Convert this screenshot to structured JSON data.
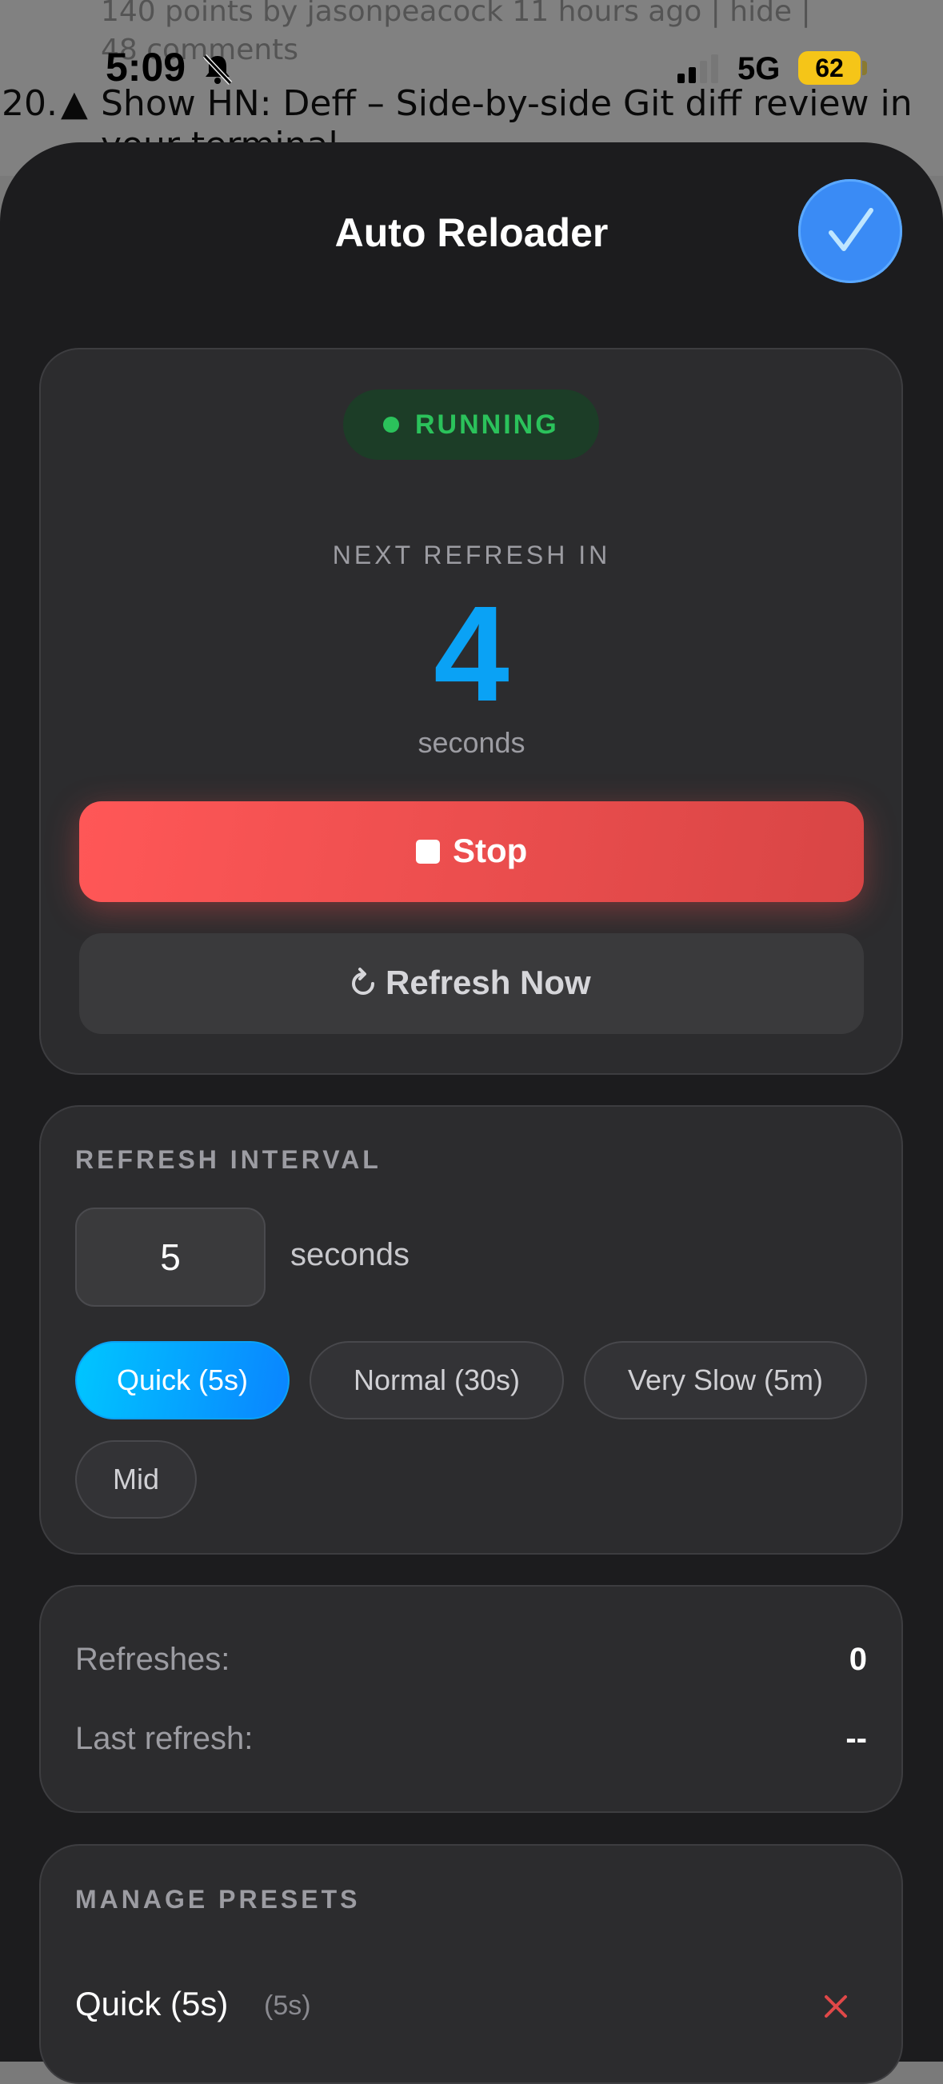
{
  "background_page": {
    "meta_line": "140 points by jasonpeacock 11 hours ago | hide |",
    "comments": "48 comments",
    "item_rank": "20.",
    "item_title": "Show HN: Deff – Side-by-side Git diff review in",
    "item_title_cont": "your terminal"
  },
  "status_bar": {
    "time": "5:09",
    "network": "5G",
    "battery": "62"
  },
  "header": {
    "title": "Auto Reloader",
    "done_icon": "checkmark-icon"
  },
  "status_card": {
    "badge": "RUNNING",
    "next_label": "NEXT REFRESH IN",
    "countdown": "4",
    "unit": "seconds",
    "stop_label": "Stop",
    "refresh_label": "Refresh Now",
    "colors": {
      "running": "#2bc25b",
      "countdown": "#0aa2f5",
      "stop": "#ff5757"
    }
  },
  "interval": {
    "title": "REFRESH INTERVAL",
    "value": "5",
    "unit": "seconds",
    "presets": [
      "Quick (5s)",
      "Normal (30s)",
      "Very Slow (5m)",
      "Mid"
    ],
    "active_preset": "Quick (5s)"
  },
  "stats": {
    "refreshes_label": "Refreshes:",
    "refreshes_value": "0",
    "last_label": "Last refresh:",
    "last_value": "--"
  },
  "manage": {
    "title": "MANAGE PRESETS",
    "items": [
      {
        "name": "Quick (5s)",
        "secs": "(5s)"
      }
    ]
  }
}
